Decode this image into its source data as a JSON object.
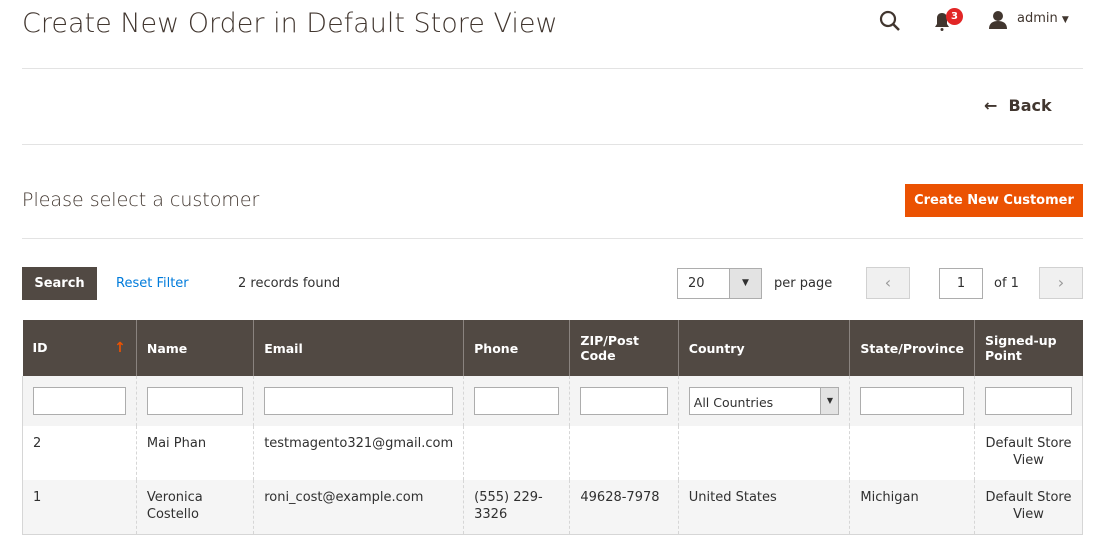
{
  "header": {
    "title": "Create New Order in Default Store View",
    "notifications": "3",
    "user": "admin",
    "icons": [
      "search-icon",
      "bell-icon",
      "user-icon",
      "caret-down-icon"
    ]
  },
  "back_label": "Back",
  "section": {
    "title": "Please select a customer",
    "create_label": "Create New Customer",
    "accent": "#eb5202"
  },
  "toolbar": {
    "search_label": "Search",
    "reset_label": "Reset Filter",
    "records": "2 records found",
    "per_page_value": "20",
    "per_page_label": "per page",
    "page": "1",
    "of_label": "of 1"
  },
  "columns": [
    "ID",
    "Name",
    "Email",
    "Phone",
    "ZIP/Post Code",
    "Country",
    "State/Province",
    "Signed-up Point"
  ],
  "filters": {
    "country": "All Countries"
  },
  "rows": [
    {
      "id": "2",
      "name": "Mai Phan",
      "email": "testmagento321@gmail.com",
      "phone": "",
      "zip": "",
      "country": "",
      "state": "",
      "point": "Default Store View"
    },
    {
      "id": "1",
      "name": "Veronica Costello",
      "email": "roni_cost@example.com",
      "phone": "(555) 229-3326",
      "zip": "49628-7978",
      "country": "United States",
      "state": "Michigan",
      "point": "Default Store View"
    }
  ]
}
